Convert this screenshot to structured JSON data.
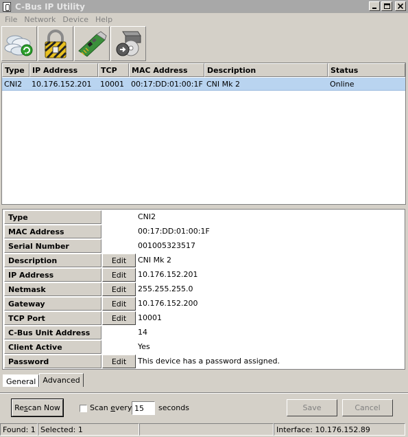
{
  "window": {
    "title": "C-Bus IP Utility"
  },
  "menu": [
    "File",
    "Network",
    "Device",
    "Help"
  ],
  "toolbar": [
    {
      "icon": "network-scan-icon"
    },
    {
      "icon": "lock-icon"
    },
    {
      "icon": "network-card-icon"
    },
    {
      "icon": "firmware-upgrade-icon"
    }
  ],
  "list": {
    "columns": [
      "Type",
      "IP Address",
      "TCP",
      "MAC Address",
      "Description",
      "Status"
    ],
    "rows": [
      {
        "type": "CNI2",
        "ip": "10.176.152.201",
        "tcp": "10001",
        "mac": "00:17:DD:01:00:1F",
        "description": "CNI Mk 2",
        "status": "Online"
      }
    ]
  },
  "details": {
    "rows": [
      {
        "label": "Type",
        "edit": "",
        "value": "CNI2"
      },
      {
        "label": "MAC Address",
        "edit": "",
        "value": "00:17:DD:01:00:1F"
      },
      {
        "label": "Serial Number",
        "edit": "",
        "value": "001005323517"
      },
      {
        "label": "Description",
        "edit": "Edit",
        "value": "CNI Mk 2"
      },
      {
        "label": "IP Address",
        "edit": "Edit",
        "value": "10.176.152.201"
      },
      {
        "label": "Netmask",
        "edit": "Edit",
        "value": "255.255.255.0"
      },
      {
        "label": "Gateway",
        "edit": "Edit",
        "value": "10.176.152.200"
      },
      {
        "label": "TCP Port",
        "edit": "Edit",
        "value": "10001"
      },
      {
        "label": "C-Bus Unit Address",
        "edit": "",
        "value": "14"
      },
      {
        "label": "Client Active",
        "edit": "",
        "value": "Yes"
      },
      {
        "label": "Password",
        "edit": "Edit",
        "value": "This device has a password assigned."
      }
    ]
  },
  "tabs": {
    "general": "General",
    "advanced": "Advanced"
  },
  "bottom": {
    "rescan": {
      "prefix": "Re",
      "u": "s",
      "suffix": "can Now"
    },
    "scan_every": {
      "prefix": "Scan ",
      "u": "e",
      "suffix": "very"
    },
    "scan_interval": "15",
    "seconds": "seconds",
    "save": "Save",
    "cancel": "Cancel"
  },
  "status": {
    "found": "Found: 1",
    "selected": "Selected: 1",
    "blank": "",
    "interface": "Interface: 10.176.152.89"
  },
  "colors": {
    "selection": "#b9d4f0",
    "face": "#d4d0c8",
    "title_inactive": "#a8a8a8"
  }
}
